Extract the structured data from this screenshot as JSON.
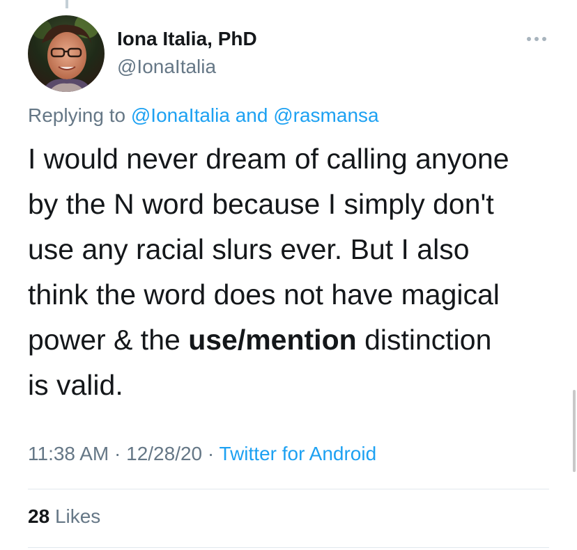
{
  "author": {
    "display_name": "Iona Italia, PhD",
    "handle": "@IonaItalia"
  },
  "reply_context": {
    "prefix": "Replying to",
    "user1": "@IonaItalia",
    "joiner": "and",
    "user2": "@rasmansa"
  },
  "tweet": {
    "line1": "I would never dream of calling anyone",
    "line2": "by the N word because I simply don't",
    "line3": "use any racial slurs ever. But I also",
    "line4": "think the word does not have magical",
    "line5_pre": "power & the ",
    "line5_bold": "use/mention",
    "line5_post": " distinction",
    "line6": "is valid."
  },
  "meta": {
    "time": "11:38 AM",
    "separator": "·",
    "date": "12/28/20",
    "source": "Twitter for Android"
  },
  "stats": {
    "likes_count": "28",
    "likes_label": "Likes"
  },
  "icons": {
    "more": "more-options-icon",
    "avatar": "profile-photo"
  },
  "colors": {
    "link": "#1da1f2",
    "secondary_text": "#657786",
    "primary_text": "#14171a"
  }
}
